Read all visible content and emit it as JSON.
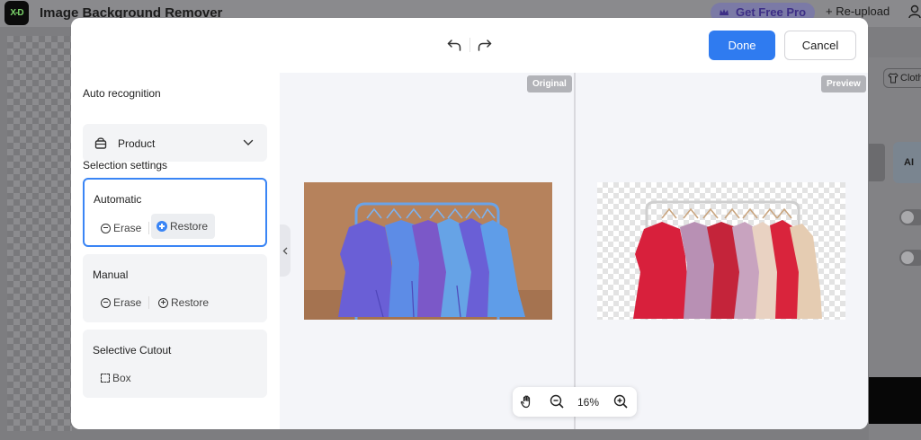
{
  "app": {
    "logo_text": "X-D",
    "title": "Image Background Remover",
    "get_pro_label": "Get Free Pro",
    "reupload_label": "+ Re-upload",
    "clothing_chip": "Cloth",
    "ai_label": "AI"
  },
  "modal": {
    "done_label": "Done",
    "cancel_label": "Cancel",
    "auto_recognition_title": "Auto recognition",
    "recognition_value": "Product",
    "selection_settings_title": "Selection settings",
    "modes": [
      {
        "title": "Automatic",
        "erase": "Erase",
        "restore": "Restore"
      },
      {
        "title": "Manual",
        "erase": "Erase",
        "restore": "Restore"
      },
      {
        "title": "Selective Cutout",
        "box": "Box"
      }
    ],
    "original_tag": "Original",
    "preview_tag": "Preview",
    "zoom_level": "16%"
  },
  "colors": {
    "accent": "#2f7bf0",
    "active_border": "#3a85f5"
  }
}
